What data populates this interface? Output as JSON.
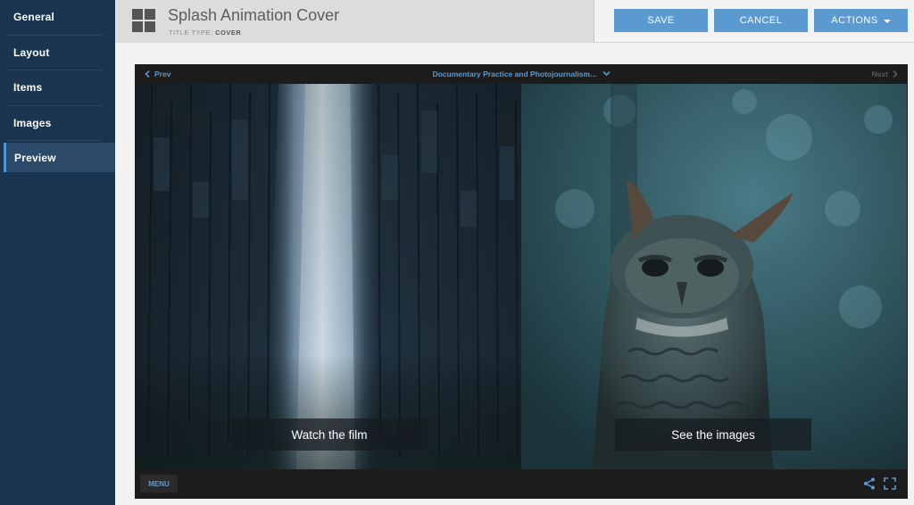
{
  "sidebar": {
    "items": [
      {
        "label": "General"
      },
      {
        "label": "Layout"
      },
      {
        "label": "Items"
      },
      {
        "label": "Images"
      },
      {
        "label": "Preview"
      }
    ],
    "active": "Preview"
  },
  "header": {
    "title": "Splash Animation Cover",
    "subtitle_label": "TITLE TYPE:",
    "subtitle_value": "COVER",
    "buttons": {
      "save": "SAVE",
      "cancel": "CANCEL",
      "actions": "ACTIONS"
    }
  },
  "preview": {
    "prev_label": "Prev",
    "next_label": "Next",
    "title": "Documentary Practice and Photojournalism...",
    "left_cta": "Watch the film",
    "right_cta": "See the images",
    "menu_label": "MENU"
  },
  "colors": {
    "sidebar_bg": "#1b3550",
    "accent": "#5b9ad0",
    "active_indicator": "#4f93d0",
    "preview_bg": "#1b1b1b"
  },
  "icons": [
    "grid-icon",
    "chevron-left-icon",
    "chevron-down-icon",
    "chevron-right-icon",
    "share-icon",
    "fullscreen-icon",
    "caret-down-icon"
  ]
}
